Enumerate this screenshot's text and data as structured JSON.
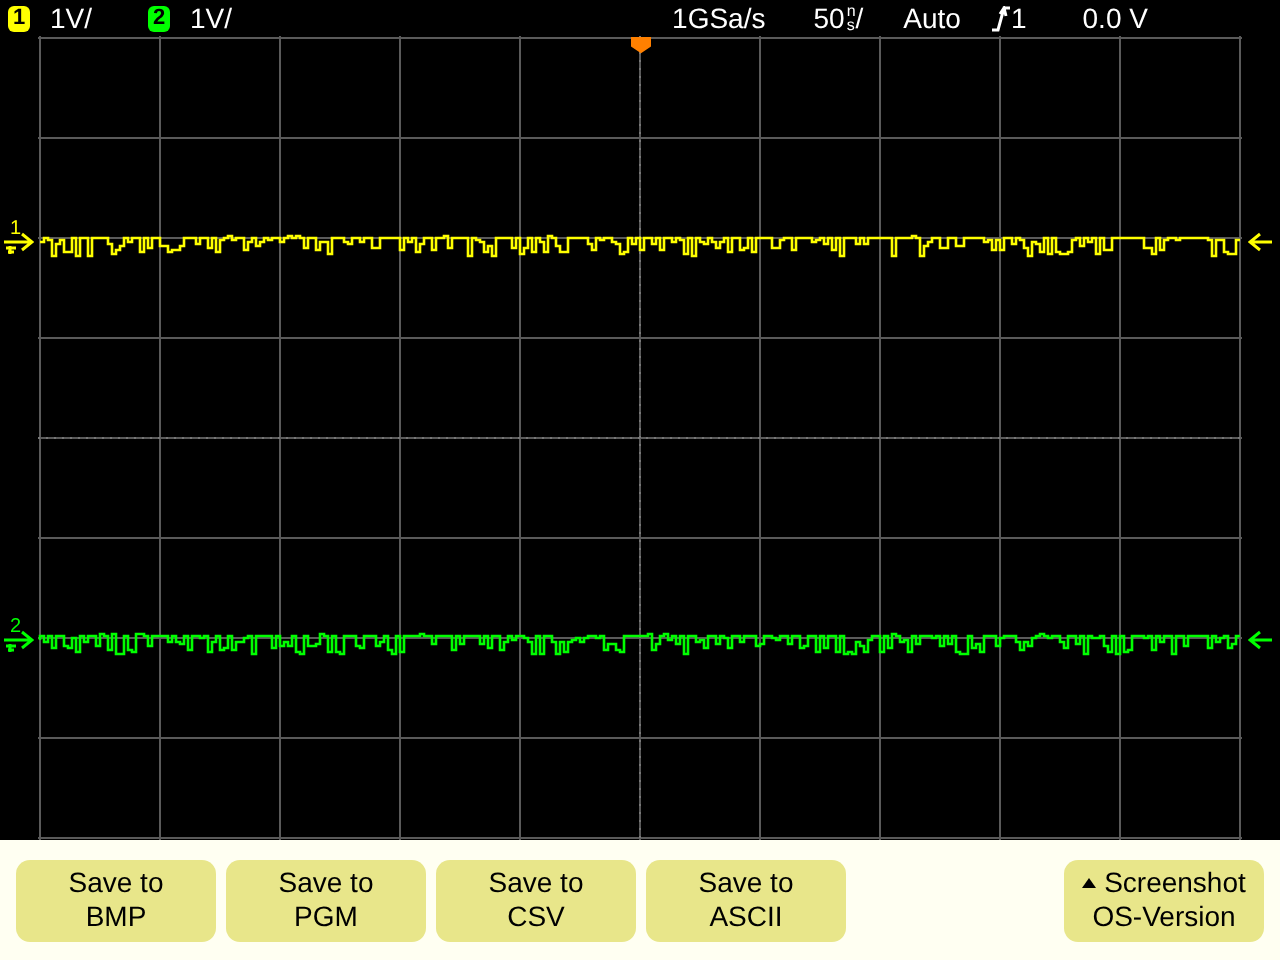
{
  "header": {
    "channels": [
      {
        "number": "1",
        "scale": "1V/",
        "color": "#ffff00"
      },
      {
        "number": "2",
        "scale": "1V/",
        "color": "#00ff00"
      }
    ],
    "sample_rate": "1GSa/s",
    "timebase": {
      "value": "50",
      "unit_top": "n",
      "unit_bottom": "s",
      "slash": "/"
    },
    "trigger_mode": "Auto",
    "trigger_source": "1",
    "trigger_level": "0.0 V"
  },
  "traces": [
    {
      "number": "1",
      "color": "#ffff00"
    },
    {
      "number": "2",
      "color": "#00ff00"
    }
  ],
  "softkeys": [
    {
      "kind": "save",
      "lines": [
        "Save to",
        "BMP"
      ]
    },
    {
      "kind": "save",
      "lines": [
        "Save to",
        "PGM"
      ]
    },
    {
      "kind": "save",
      "lines": [
        "Save to",
        "CSV"
      ]
    },
    {
      "kind": "save",
      "lines": [
        "Save to",
        "ASCII"
      ]
    },
    {
      "kind": "menu",
      "lines": [
        "Screenshot",
        "OS-Version"
      ]
    }
  ]
}
